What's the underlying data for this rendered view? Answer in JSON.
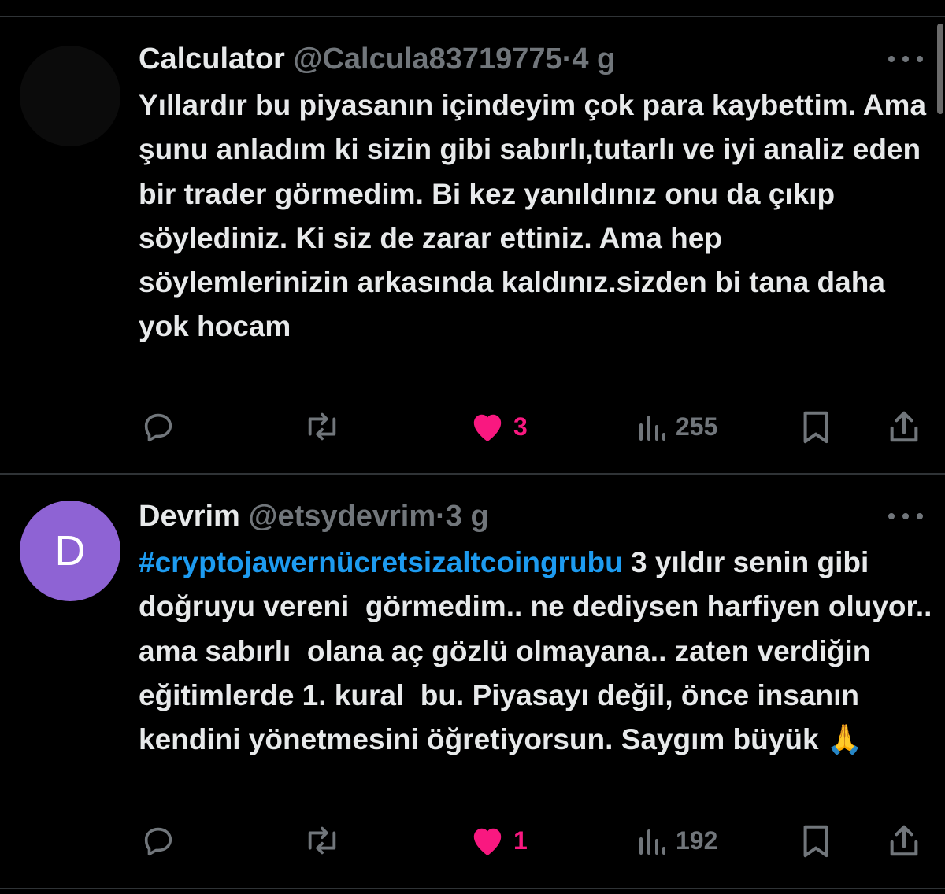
{
  "tweets": [
    {
      "name": "Calculator",
      "handle": "@Calcula83719775",
      "dot": "·",
      "time": "4 g",
      "hashtag": "",
      "text": "Yıllardır bu piyasanın içindeyim çok para kaybettim. Ama şunu anladım ki sizin gibi sabırlı,tutarlı ve iyi analiz eden bir trader görmedim. Bi kez yanıldınız onu da çıkıp söylediniz. Ki siz de zarar ettiniz. Ama hep söylemlerinizin arkasında kaldınız.sizden bi tana daha yok hocam",
      "likes": "3",
      "views": "255"
    },
    {
      "name": "Devrim",
      "handle": "@etsydevrim",
      "dot": "·",
      "time": "3 g",
      "avatar_letter": "D",
      "hashtag": "#cryptojawernücretsizaltcoingrubu",
      "text": " 3 yıldır senin gibi  doğruyu vereni  görmedim.. ne dediysen harfiyen oluyor..  ama sabırlı  olana aç gözlü olmayana.. zaten verdiğin eğitimlerde 1. kural  bu. Piyasayı değil, önce insanın kendini yönetmesini öğretiyorsun. Saygım büyük 🙏",
      "likes": "1",
      "views": "192"
    }
  ],
  "colors": {
    "background": "#000000",
    "text": "#e7e9ea",
    "muted": "#71767b",
    "hashtag": "#1d9bf0",
    "like": "#f91880",
    "avatar_devrim": "#8e63d4"
  },
  "icons": [
    "reply-icon",
    "retweet-icon",
    "like-heart-icon",
    "views-icon",
    "bookmark-icon",
    "share-icon",
    "more-icon"
  ]
}
